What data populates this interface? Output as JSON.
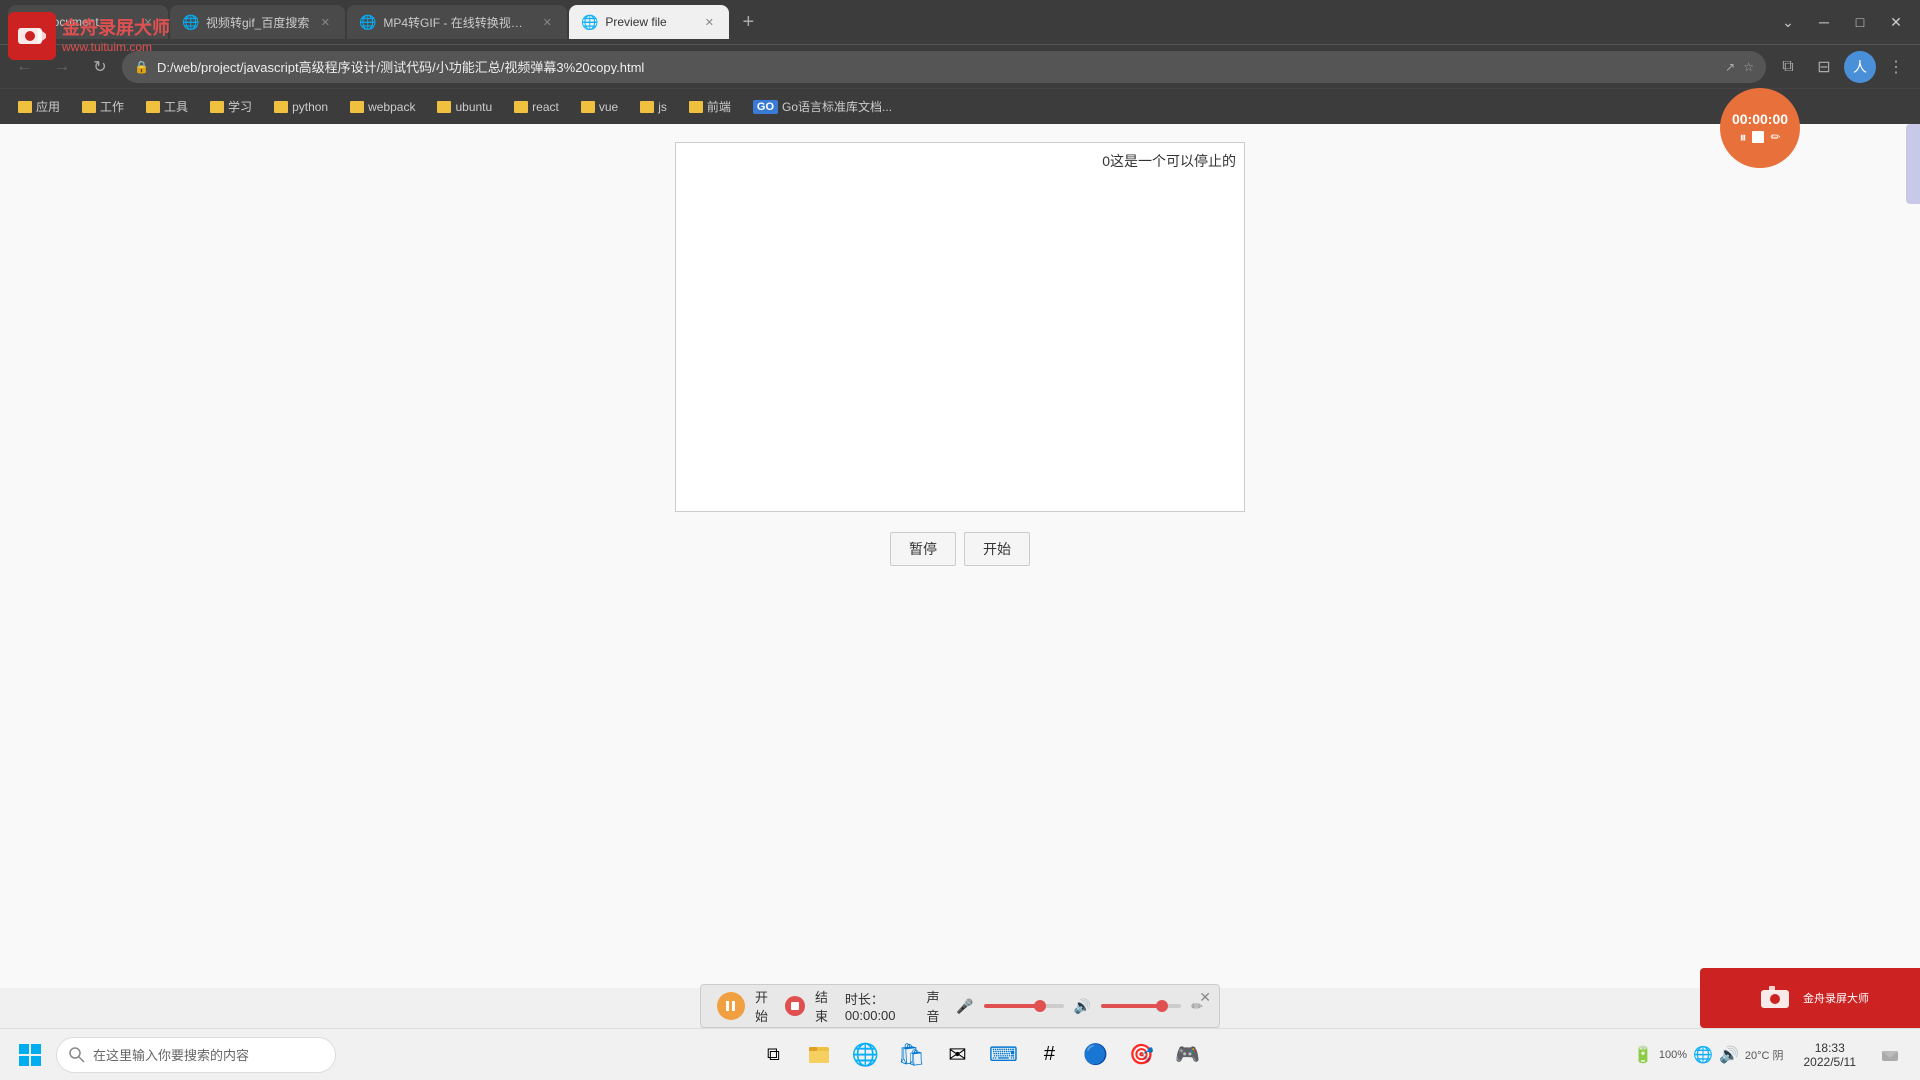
{
  "tabs": [
    {
      "id": "document",
      "label": "Document",
      "favicon": "📄",
      "active": false,
      "closeable": true
    },
    {
      "id": "video-search",
      "label": "视频转gif_百度搜索",
      "favicon": "🔵",
      "active": false,
      "closeable": true
    },
    {
      "id": "mp4gif",
      "label": "MP4转GIF - 在线转换视频文件",
      "favicon": "🔵",
      "active": false,
      "closeable": true
    },
    {
      "id": "preview",
      "label": "Preview file",
      "favicon": "🔵",
      "active": true,
      "closeable": true
    }
  ],
  "address_bar": {
    "url": "D:/web/project/javascript高级程序设计/测试代码/小功能汇总/视频弹幕3%20copy.html",
    "security_icon": "🔒"
  },
  "bookmarks": [
    {
      "id": "apps",
      "label": "应用",
      "type": "folder"
    },
    {
      "id": "work",
      "label": "工作",
      "type": "folder"
    },
    {
      "id": "tools",
      "label": "工具",
      "type": "folder"
    },
    {
      "id": "study",
      "label": "学习",
      "type": "folder"
    },
    {
      "id": "python",
      "label": "python",
      "type": "folder"
    },
    {
      "id": "webpack",
      "label": "webpack",
      "type": "folder"
    },
    {
      "id": "ubuntu",
      "label": "ubuntu",
      "type": "folder"
    },
    {
      "id": "react",
      "label": "react",
      "type": "folder"
    },
    {
      "id": "vue",
      "label": "vue",
      "type": "folder"
    },
    {
      "id": "js",
      "label": "js",
      "type": "folder"
    },
    {
      "id": "frontend",
      "label": "前端",
      "type": "folder"
    },
    {
      "id": "go-docs",
      "label": "Go语言标准库文档...",
      "type": "go"
    }
  ],
  "page": {
    "video_text": "0这是一个可以停止的",
    "pause_btn_label": "暂停",
    "start_btn_label": "开始"
  },
  "recording_timer": {
    "time": "00:00:00"
  },
  "recording_toolbar": {
    "start_label": "开始",
    "end_label": "结束",
    "duration_label": "时长：",
    "duration_value": "00:00:00",
    "audio_label": "声音",
    "close_label": "×"
  },
  "taskbar": {
    "search_placeholder": "在这里输入你要搜索的内容",
    "datetime": {
      "time": "18:33",
      "date": "2022/5/11"
    },
    "weather": {
      "temp": "20°C",
      "condition": "阴"
    },
    "battery": "100%"
  },
  "watermark": {
    "app_name": "金舟录屏大师",
    "website": "www.tuituim.com"
  }
}
